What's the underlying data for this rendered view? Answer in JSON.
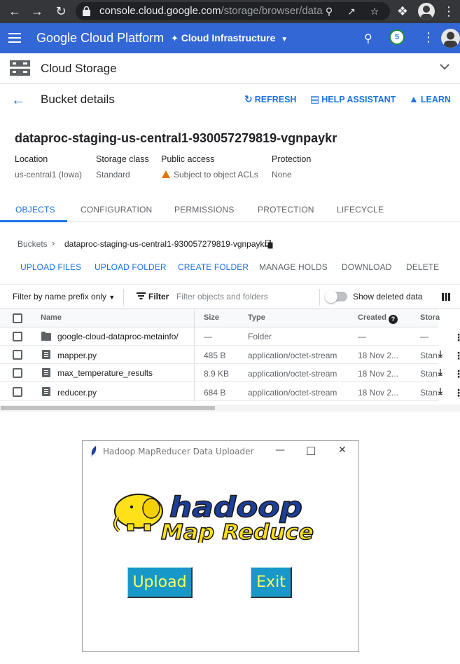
{
  "browser": {
    "url_host": "console.cloud.google.com",
    "url_path": "/storage/browser/data..."
  },
  "header": {
    "brand": "Google Cloud Platform",
    "project": "Cloud Infrastructure",
    "notifications": "5"
  },
  "product": {
    "title": "Cloud Storage"
  },
  "page": {
    "title": "Bucket details",
    "refresh": "REFRESH",
    "help": "HELP ASSISTANT",
    "learn": "LEARN"
  },
  "bucket": {
    "name": "dataproc-staging-us-central1-930057279819-vgnpaykr",
    "location_label": "Location",
    "location": "us-central1 (Iowa)",
    "storage_class_label": "Storage class",
    "storage_class": "Standard",
    "public_access_label": "Public access",
    "public_access": "Subject to object ACLs",
    "protection_label": "Protection",
    "protection": "None"
  },
  "tabs": [
    "OBJECTS",
    "CONFIGURATION",
    "PERMISSIONS",
    "PROTECTION",
    "LIFECYCLE"
  ],
  "breadcrumb": {
    "root": "Buckets",
    "current": "dataproc-staging-us-central1-930057279819-vgnpaykr"
  },
  "actions": [
    "UPLOAD FILES",
    "UPLOAD FOLDER",
    "CREATE FOLDER",
    "MANAGE HOLDS",
    "DOWNLOAD",
    "DELETE"
  ],
  "filter": {
    "prefix": "Filter by name prefix only",
    "label": "Filter",
    "placeholder": "Filter objects and folders",
    "show_deleted": "Show deleted data"
  },
  "table": {
    "columns": [
      "Name",
      "Size",
      "Type",
      "Created",
      "Stora"
    ],
    "rows": [
      {
        "name": "google-cloud-dataproc-metainfo/",
        "size": "—",
        "type": "Folder",
        "created": "—",
        "storage": "—",
        "kind": "folder"
      },
      {
        "name": "mapper.py",
        "size": "485 B",
        "type": "application/octet-stream",
        "created": "18 Nov 2...",
        "storage": "Stan",
        "kind": "file"
      },
      {
        "name": "max_temperature_results",
        "size": "8.9 KB",
        "type": "application/octet-stream",
        "created": "18 Nov 2...",
        "storage": "Stan",
        "kind": "file"
      },
      {
        "name": "reducer.py",
        "size": "684 B",
        "type": "application/octet-stream",
        "created": "18 Nov 2...",
        "storage": "Stan",
        "kind": "file"
      }
    ]
  },
  "dialog": {
    "title": "Hadoop MapReducer Data Uploader",
    "logo_text_1": "hadoop",
    "logo_text_2": "Map Reduce",
    "upload": "Upload",
    "exit": "Exit"
  },
  "colors": {
    "gcp_blue": "#3367d6",
    "link_blue": "#1a73e8",
    "tk_button": "#1798c8",
    "tk_button_text": "#ffff5c"
  }
}
